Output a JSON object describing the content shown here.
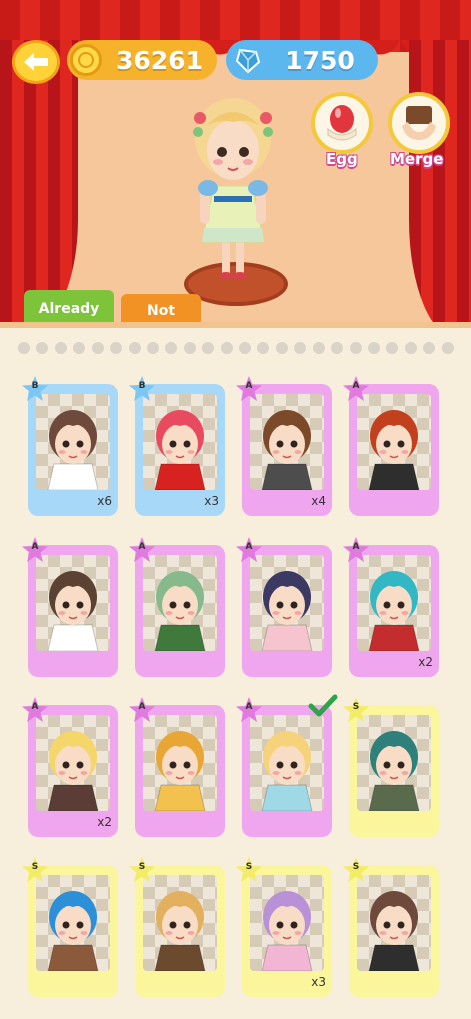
{
  "currency": {
    "coins": "36261",
    "gems": "1750"
  },
  "actions": {
    "egg": "Egg",
    "merge": "Merge"
  },
  "tabs": {
    "already": "Already",
    "not": "Not"
  },
  "colors": {
    "B": "#a7d8f7",
    "A": "#f0a6ee",
    "S": "#fbf59c",
    "starB": "#7cc6f4",
    "starA": "#e07adf",
    "starS": "#f2ec67"
  },
  "cards": [
    {
      "grade": "B",
      "count": "x6",
      "hair": "#6d4a3c",
      "outfit": "#ffffff",
      "selected": false
    },
    {
      "grade": "B",
      "count": "x3",
      "hair": "#e84b5f",
      "outfit": "#d8221f",
      "selected": false
    },
    {
      "grade": "A",
      "count": "x4",
      "hair": "#7b4a2a",
      "outfit": "#4d4d4d",
      "selected": false
    },
    {
      "grade": "A",
      "count": "",
      "hair": "#c2401e",
      "outfit": "#2e2e2e",
      "selected": false
    },
    {
      "grade": "A",
      "count": "",
      "hair": "#5b4232",
      "outfit": "#ffffff",
      "selected": false
    },
    {
      "grade": "A",
      "count": "",
      "hair": "#86b98c",
      "outfit": "#3f7a3c",
      "selected": false
    },
    {
      "grade": "A",
      "count": "",
      "hair": "#3c3a63",
      "outfit": "#f5c4cf",
      "selected": false
    },
    {
      "grade": "A",
      "count": "x2",
      "hair": "#33b7c4",
      "outfit": "#c42d2d",
      "selected": false
    },
    {
      "grade": "A",
      "count": "x2",
      "hair": "#f4d66a",
      "outfit": "#5b3c37",
      "selected": false
    },
    {
      "grade": "A",
      "count": "",
      "hair": "#e8a635",
      "outfit": "#f2c14e",
      "selected": false
    },
    {
      "grade": "A",
      "count": "",
      "hair": "#f6d37a",
      "outfit": "#9fd9e6",
      "selected": true
    },
    {
      "grade": "S",
      "count": "",
      "hair": "#2f7f7a",
      "outfit": "#5a6a4d",
      "selected": false
    },
    {
      "grade": "S",
      "count": "",
      "hair": "#2d8fd8",
      "outfit": "#8b5a3a",
      "selected": false
    },
    {
      "grade": "S",
      "count": "",
      "hair": "#e2b05e",
      "outfit": "#6b4a2e",
      "selected": false
    },
    {
      "grade": "S",
      "count": "x3",
      "hair": "#b891d6",
      "outfit": "#f2b5d3",
      "selected": false
    },
    {
      "grade": "S",
      "count": "",
      "hair": "#6d4a3c",
      "outfit": "#2e2e2e",
      "selected": false
    }
  ]
}
